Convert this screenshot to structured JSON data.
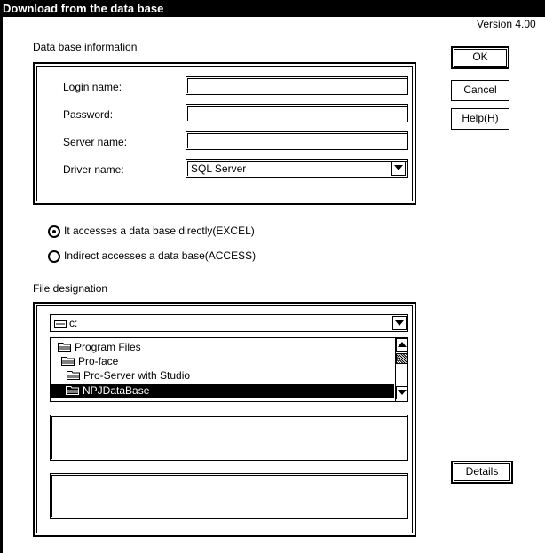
{
  "window": {
    "title": "Download from the data base"
  },
  "version": "Version 4.00",
  "db_info": {
    "label": "Data base information",
    "login_label": "Login name:",
    "login_value": "",
    "password_label": "Password:",
    "password_value": "",
    "server_label": "Server name:",
    "server_value": "",
    "driver_label": "Driver name:",
    "driver_value": "SQL Server"
  },
  "buttons": {
    "ok": "OK",
    "cancel": "Cancel",
    "help": "Help(H)",
    "details": "Details"
  },
  "access_mode": {
    "direct": "It accesses a data base directly(EXCEL)",
    "indirect": "Indirect accesses a data base(ACCESS)",
    "selected": "direct"
  },
  "file_designation": {
    "label": "File designation",
    "drive": "c:",
    "folders": [
      {
        "name": "Program Files",
        "selected": false
      },
      {
        "name": "Pro-face",
        "selected": false
      },
      {
        "name": "Pro-Server with Studio",
        "selected": false
      },
      {
        "name": "NPJDataBase",
        "selected": true
      }
    ]
  }
}
